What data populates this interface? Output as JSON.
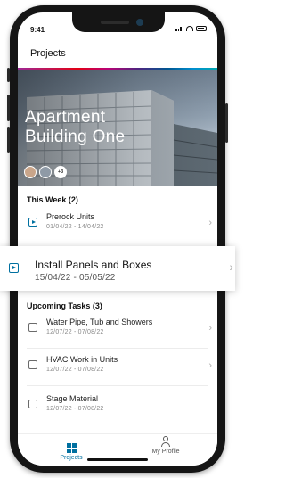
{
  "status": {
    "time": "9:41"
  },
  "nav": {
    "title": "Projects"
  },
  "project": {
    "name": "Apartment Building One",
    "extra_members": "+3"
  },
  "this_week": {
    "heading": "This Week (2)",
    "tasks": [
      {
        "title": "Prerock Units",
        "dates": "01/04/22 - 14/04/22"
      },
      {
        "title": "Install Panels and Boxes",
        "dates": "15/04/22 - 05/05/22"
      }
    ]
  },
  "upcoming": {
    "heading": "Upcoming Tasks (3)",
    "tasks": [
      {
        "title": "Water Pipe, Tub and Showers",
        "dates": "12/07/22 - 07/08/22"
      },
      {
        "title": "HVAC Work in Units",
        "dates": "12/07/22 - 07/08/22"
      },
      {
        "title": "Stage Material",
        "dates": "12/07/22 - 07/08/22"
      }
    ]
  },
  "tabs": [
    {
      "label": "Projects",
      "icon": "grid-icon",
      "active": true
    },
    {
      "label": "My Profile",
      "icon": "person-icon",
      "active": false
    }
  ],
  "colors": {
    "accent": "#0070a0",
    "text": "#111111",
    "muted": "#888888"
  }
}
